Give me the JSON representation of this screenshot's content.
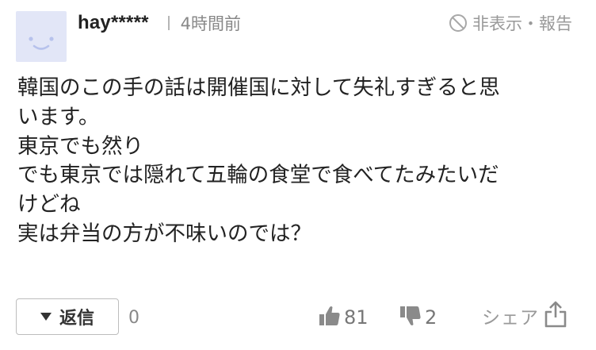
{
  "comment": {
    "username": "hay*****",
    "time": "4時間前",
    "hide_report": "非表示・報告",
    "lines": [
      "韓国のこの手の話は開催国に対して失礼すぎると思",
      "います。",
      "東京でも然り",
      "でも東京では隠れて五輪の食堂で食べてたみたいだ",
      "けどね",
      "実は弁当の方が不味いのでは？"
    ],
    "reply_label": "返信",
    "reply_count": "0",
    "like_count": "81",
    "dislike_count": "2",
    "share_label": "シェア"
  },
  "icons": {
    "avatar": "smiley-face-icon",
    "hide": "ban-icon",
    "reply": "triangle-down-icon",
    "like": "thumbs-up-icon",
    "dislike": "thumbs-down-icon",
    "share": "share-icon"
  },
  "colors": {
    "avatar_bg": "#e2e6f7",
    "avatar_face": "#b7c2ec",
    "muted_text": "#999999",
    "body_text": "#222222"
  }
}
